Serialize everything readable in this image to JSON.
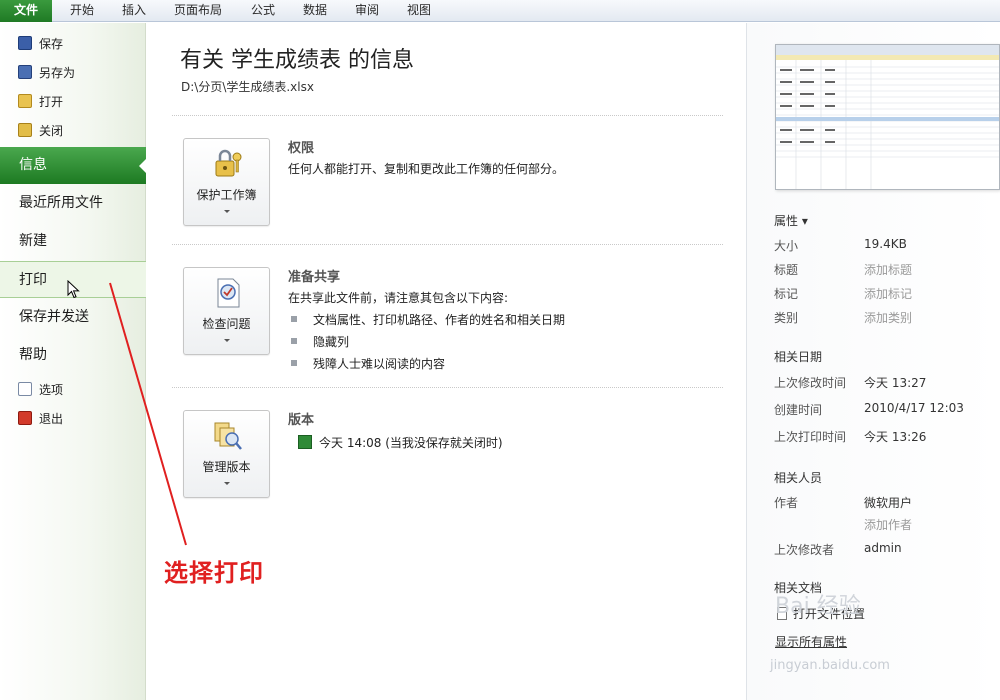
{
  "ribbon": {
    "file_tab": "文件",
    "tabs": [
      "开始",
      "插入",
      "页面布局",
      "公式",
      "数据",
      "审阅",
      "视图"
    ]
  },
  "leftnav": {
    "save": "保存",
    "save_as": "另存为",
    "open": "打开",
    "close": "关闭",
    "info": "信息",
    "recent": "最近所用文件",
    "new": "新建",
    "print": "打印",
    "save_send": "保存并发送",
    "help": "帮助",
    "options": "选项",
    "exit": "退出",
    "active_item": "信息",
    "hover_item": "打印"
  },
  "main": {
    "title": "有关 学生成绩表 的信息",
    "path": "D:\\分页\\学生成绩表.xlsx",
    "permissions": {
      "button": "保护工作簿",
      "title": "权限",
      "desc": "任何人都能打开、复制和更改此工作簿的任何部分。"
    },
    "prepare": {
      "button": "检查问题",
      "title": "准备共享",
      "desc": "在共享此文件前，请注意其包含以下内容:",
      "bullets": [
        "文档属性、打印机路径、作者的姓名和相关日期",
        "隐藏列",
        "残障人士难以阅读的内容"
      ]
    },
    "versions": {
      "button": "管理版本",
      "title": "版本",
      "entry": "今天 14:08 (当我没保存就关闭时)"
    }
  },
  "annotation": {
    "text": "选择打印",
    "color": "#e02020"
  },
  "properties": {
    "header": "属性 ▾",
    "size_label": "大小",
    "size_value": "19.4KB",
    "title_label": "标题",
    "title_value": "添加标题",
    "tags_label": "标记",
    "tags_value": "添加标记",
    "category_label": "类别",
    "category_value": "添加类别",
    "dates_header": "相关日期",
    "modified_label": "上次修改时间",
    "modified_value": "今天 13:27",
    "created_label": "创建时间",
    "created_value": "2010/4/17 12:03",
    "printed_label": "上次打印时间",
    "printed_value": "今天 13:26",
    "people_header": "相关人员",
    "author_label": "作者",
    "author_value": "微软用户",
    "add_author": "添加作者",
    "last_modified_by_label": "上次修改者",
    "last_modified_by_value": "admin",
    "docs_header": "相关文档",
    "open_location": "打开文件位置",
    "show_all": "显示所有属性"
  },
  "watermark": {
    "text": "Bai 经验",
    "sub": "jingyan.baidu.com"
  },
  "colors": {
    "accent_green": "#1f7a24",
    "annotation_red": "#e02020"
  }
}
